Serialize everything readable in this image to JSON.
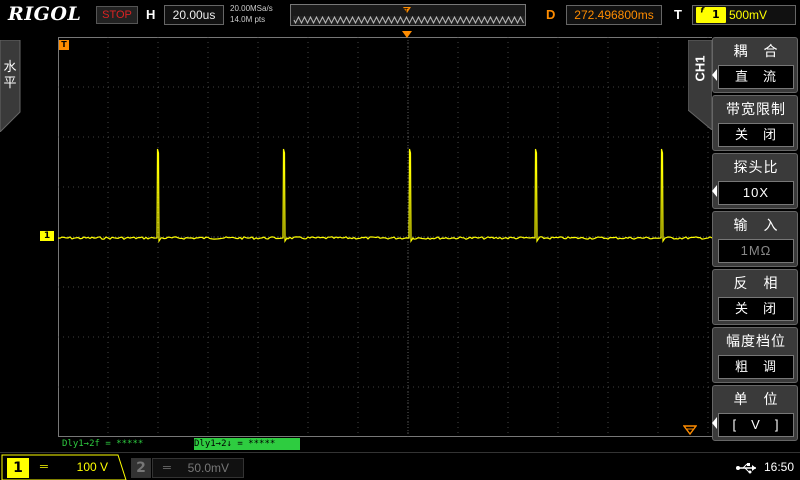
{
  "top": {
    "logo": "RIGOL",
    "run_status": "STOP",
    "horiz_label": "H",
    "timebase": "20.00us",
    "sample_rate": "20.00MSa/s",
    "mem_depth": "14.0M pts",
    "delay_label": "D",
    "delay_value": "272.496800ms",
    "trigger_label": "T",
    "trigger_mode": "f",
    "trigger_level": "500mV"
  },
  "left_tab": {
    "label": "水\n平"
  },
  "menu": {
    "channel_tab": "CH1",
    "items": [
      {
        "title": "耦　合",
        "value": "直　流"
      },
      {
        "title": "带宽限制",
        "value": "关　闭"
      },
      {
        "title": "探头比",
        "value": "10X"
      },
      {
        "title": "输　入",
        "value": "1MΩ"
      },
      {
        "title": "反　相",
        "value": "关　闭"
      },
      {
        "title": "幅度档位",
        "value": "粗　调"
      },
      {
        "title": "单　位",
        "value": "[　V　]"
      }
    ]
  },
  "delays": {
    "dly1": "Dly1→2f  = *****",
    "dly2": "Dly1→2↓  = *****"
  },
  "bottom": {
    "ch1_number": "1",
    "ch1_coupling": "═",
    "ch1_scale": "100 V",
    "ch2_number": "2",
    "ch2_coupling": "═",
    "ch2_scale": "50.0mV",
    "time": "16:50"
  },
  "colors": {
    "ch1": "#ffff00",
    "ch2": "#555555",
    "trigger": "#ff8c00",
    "accent_orange": "#ff8c00"
  },
  "markers": {
    "ch1_ground": "1",
    "trigger_marker": "T"
  }
}
